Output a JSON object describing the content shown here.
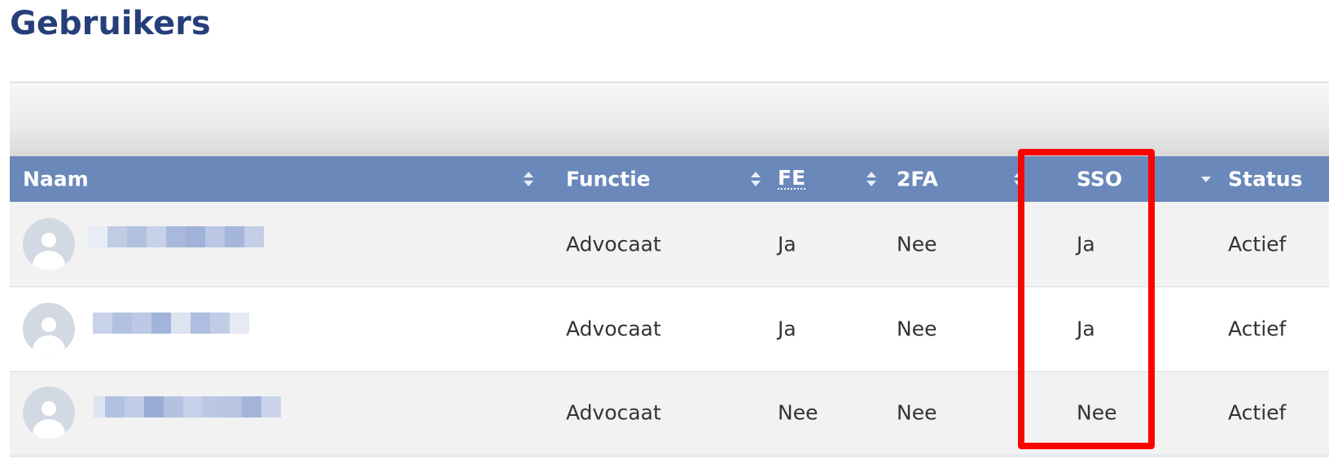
{
  "page": {
    "title": "Gebruikers"
  },
  "table": {
    "columns": {
      "naam": "Naam",
      "functie": "Functie",
      "fe": "FE",
      "twofa": "2FA",
      "sso": "SSO",
      "status": "Status"
    },
    "rows": [
      {
        "functie": "Advocaat",
        "fe": "Ja",
        "twofa": "Nee",
        "sso": "Ja",
        "status": "Actief"
      },
      {
        "functie": "Advocaat",
        "fe": "Ja",
        "twofa": "Nee",
        "sso": "Ja",
        "status": "Actief"
      },
      {
        "functie": "Advocaat",
        "fe": "Nee",
        "twofa": "Nee",
        "sso": "Nee",
        "status": "Actief"
      }
    ]
  },
  "icons": {
    "sortable": "sort-both-icon",
    "sorted_desc": "sort-desc-icon",
    "avatar": "user-avatar-icon"
  },
  "colors": {
    "title": "#263f7a",
    "header_bg": "#6a88ba",
    "highlight": "#ff0000"
  }
}
